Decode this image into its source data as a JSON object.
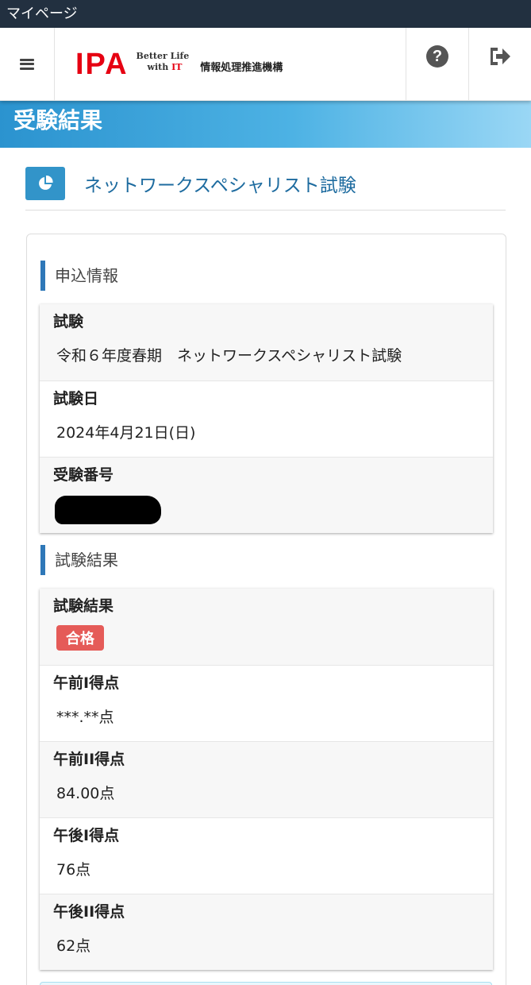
{
  "statusbar": {
    "title": "マイページ"
  },
  "header": {
    "logo_text": "IPA",
    "tagline_line1": "Better Life",
    "tagline_line2_prefix": "with ",
    "tagline_line2_it": "IT",
    "org_name": "情報処理推進機構",
    "help_label": "?",
    "icons": [
      "menu-icon",
      "help-icon",
      "logout-icon"
    ]
  },
  "banner": {
    "title": "受験結果"
  },
  "exam": {
    "icon": "pie-chart-icon",
    "title": "ネットワークスペシャリスト試験"
  },
  "application_section": {
    "title": "申込情報",
    "rows": [
      {
        "label": "試験",
        "value": "令和６年度春期　ネットワークスペシャリスト試験"
      },
      {
        "label": "試験日",
        "value": "2024年4月21日(日)"
      },
      {
        "label": "受験番号",
        "value": ""
      }
    ]
  },
  "result_section": {
    "title": "試験結果",
    "result_label": "試験結果",
    "result_badge": "合格",
    "scores": [
      {
        "label": "午前I得点",
        "value": "***.**点"
      },
      {
        "label": "午前II得点",
        "value": "84.00点"
      },
      {
        "label": "午後I得点",
        "value": "76点"
      },
      {
        "label": "午後II得点",
        "value": "62点"
      }
    ]
  },
  "colors": {
    "status_bar": "#223040",
    "accent_blue": "#2f78b8",
    "brand_red": "#e60012",
    "pass_badge": "#e55b58"
  }
}
